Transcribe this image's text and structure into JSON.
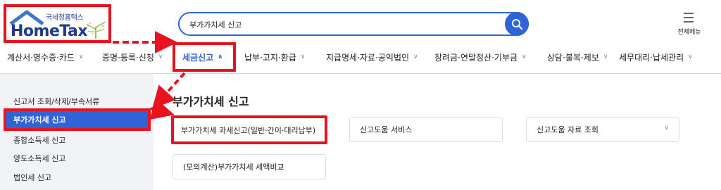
{
  "header": {
    "logo_subtitle": "국세청홈택스",
    "logo_title": "HomeTax",
    "search_value": "부가가치세 신고",
    "menu_label": "전체메뉴"
  },
  "nav": [
    {
      "label": "계산서·영수증·카드"
    },
    {
      "label": "증명·등록·신청"
    },
    {
      "label": "세금신고"
    },
    {
      "label": "납부·고지·환급"
    },
    {
      "label": "지급명세·자료·공익법인"
    },
    {
      "label": "장려금·연말정산·기부금"
    },
    {
      "label": "상담·불복·제보"
    },
    {
      "label": "세무대리·납세관리"
    }
  ],
  "sidebar": {
    "items": [
      {
        "label": "신고서 조회/삭제/부속서류"
      },
      {
        "label": "부가가치세 신고"
      },
      {
        "label": "종합소득세 신고"
      },
      {
        "label": "양도소득세 신고"
      },
      {
        "label": "법인세 신고"
      }
    ]
  },
  "main": {
    "title": "부가가치세 신고",
    "cards": [
      {
        "label": "부가가치세 과세신고(일반·간이·대리납부)"
      },
      {
        "label": "신고도움 서비스"
      },
      {
        "label": "신고도움 자료 조회"
      },
      {
        "label": "(모의계산)부가가치세 세액비교"
      }
    ]
  },
  "colors": {
    "accent_blue": "#2f64d8",
    "highlight_red": "#e8131e",
    "logo_navy": "#1f3b8e"
  },
  "icons": {
    "search": "search-icon",
    "menu": "hamburger-menu-icon",
    "chevron_down": "chevron-down-icon",
    "chevron_up": "chevron-up-icon"
  }
}
